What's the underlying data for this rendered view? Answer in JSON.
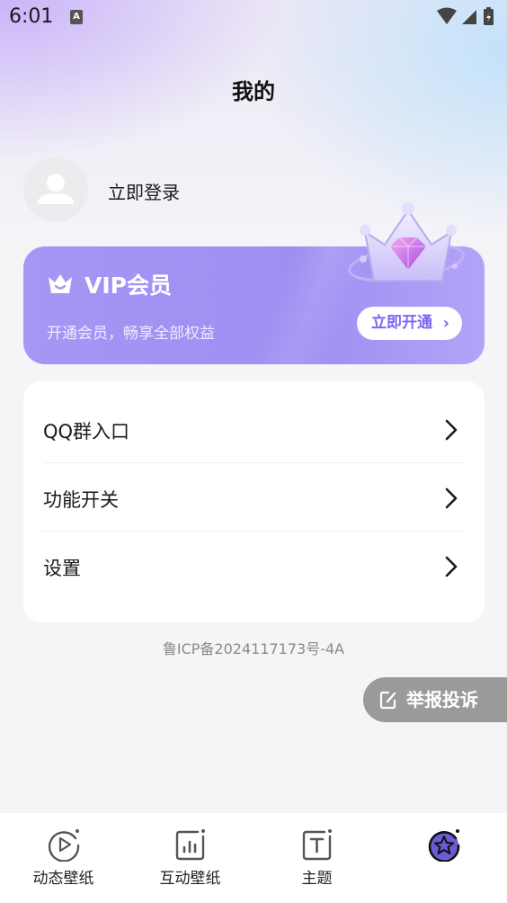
{
  "status_bar": {
    "time": "6:01",
    "notification_icon": "a-icon",
    "icons": [
      "wifi-icon",
      "signal-icon",
      "battery-icon"
    ]
  },
  "header": {
    "title": "我的"
  },
  "profile": {
    "login_label": "立即登录",
    "avatar_icon": "user-icon"
  },
  "vip": {
    "title": "VIP会员",
    "subtitle": "开通会员，畅享全部权益",
    "button_label": "立即开通",
    "accent": "#9d8ef2",
    "button_text_color": "#7c66f0"
  },
  "menu": {
    "items": [
      {
        "label": "QQ群入口"
      },
      {
        "label": "功能开关"
      },
      {
        "label": "设置"
      }
    ]
  },
  "icp": "鲁ICP备2024117173号-4A",
  "report": {
    "label": "举报投诉"
  },
  "tabbar": {
    "tabs": [
      {
        "label": "动态壁纸",
        "icon": "play-icon",
        "active": false
      },
      {
        "label": "互动壁纸",
        "icon": "bar-chart-icon",
        "active": false
      },
      {
        "label": "主题",
        "icon": "text-icon",
        "active": false
      },
      {
        "label": "",
        "icon": "star-icon",
        "active": true
      }
    ]
  }
}
